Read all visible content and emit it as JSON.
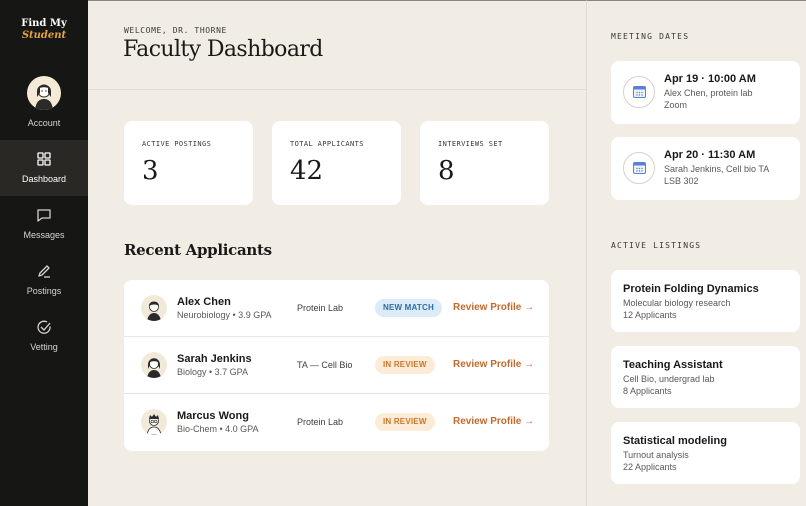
{
  "brand": {
    "line1": "Find My",
    "line2": "Student"
  },
  "sidebar": {
    "account_label": "Account",
    "items": [
      {
        "label": "Dashboard",
        "icon": "grid-icon",
        "active": true
      },
      {
        "label": "Messages",
        "icon": "message-icon",
        "active": false
      },
      {
        "label": "Postings",
        "icon": "pencil-icon",
        "active": false
      },
      {
        "label": "Vetting",
        "icon": "check-circle-icon",
        "active": false
      }
    ]
  },
  "header": {
    "welcome": "WELCOME, DR. THORNE",
    "title": "Faculty Dashboard"
  },
  "stats": [
    {
      "label": "ACTIVE POSTINGS",
      "value": "3"
    },
    {
      "label": "TOTAL APPLICANTS",
      "value": "42"
    },
    {
      "label": "INTERVIEWS SET",
      "value": "8"
    }
  ],
  "recent": {
    "title": "Recent Applicants",
    "rows": [
      {
        "name": "Alex Chen",
        "detail": "Neurobiology • 3.9 GPA",
        "group": "Protein Lab",
        "status": "NEW MATCH",
        "action": "Review Profile →"
      },
      {
        "name": "Sarah Jenkins",
        "detail": "Biology • 3.7 GPA",
        "group": "TA — Cell Bio",
        "status": "IN REVIEW",
        "action": "Review Profile →"
      },
      {
        "name": "Marcus Wong",
        "detail": "Bio-Chem • 4.0 GPA",
        "group": "Protein Lab",
        "status": "IN REVIEW",
        "action": "Review Profile →"
      }
    ]
  },
  "meetings": {
    "label": "MEETING DATES",
    "items": [
      {
        "time": "Apr 19 · 10:00 AM",
        "line1": "Alex Chen, protein lab",
        "line2": "Zoom"
      },
      {
        "time": "Apr 20 · 11:30 AM",
        "line1": "Sarah Jenkins, Cell bio TA",
        "line2": "LSB 302"
      }
    ]
  },
  "listings": {
    "label": "ACTIVE LISTINGS",
    "items": [
      {
        "title": "Protein Folding Dynamics",
        "line1": "Molecular biology research",
        "line2": "12 Applicants"
      },
      {
        "title": "Teaching Assistant",
        "line1": "Cell Bio, undergrad lab",
        "line2": "8 Applicants"
      },
      {
        "title": "Statistical modeling",
        "line1": "Turnout analysis",
        "line2": "22 Applicants"
      }
    ]
  },
  "colors": {
    "sidebar": "#161615",
    "accent": "#e3a43b",
    "link": "#c26a2e",
    "match_badge": "#dcebf8",
    "review_badge": "#fcebd6",
    "calendar": "#5a7fd6"
  }
}
